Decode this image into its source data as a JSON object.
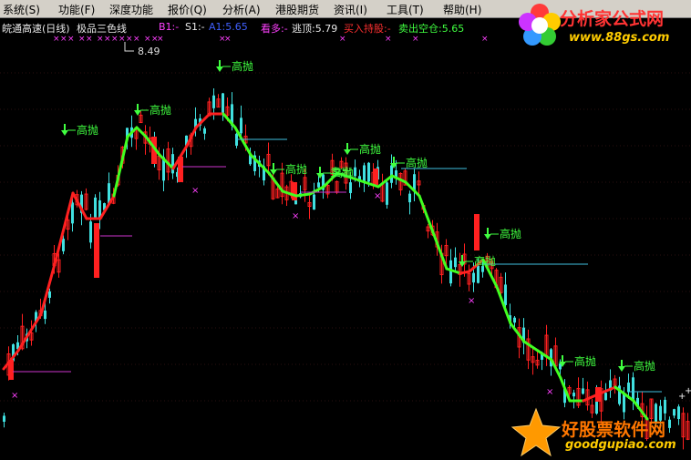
{
  "menu": [
    {
      "label": "系统(S)"
    },
    {
      "label": "功能(F)"
    },
    {
      "label": "深度功能"
    },
    {
      "label": "报价(Q)"
    },
    {
      "label": "分析(A)"
    },
    {
      "label": "港股期货"
    },
    {
      "label": "资讯(I)"
    },
    {
      "label": "工具(T)"
    },
    {
      "label": "帮助(H)"
    }
  ],
  "indicator": {
    "stock": "皖通高速(日线)",
    "name": "极品三色线",
    "b1": "B1:-",
    "s1": "S1:-",
    "a1": "A1:5.65",
    "kanduo": "看多:-",
    "taoding": "逃顶:5.79",
    "mairu": "买入持股:-",
    "maichu": "卖出空仓:5.65"
  },
  "chart_data": {
    "type": "candlestick",
    "high_marker": "8.49",
    "signal_label": "高抛",
    "overlay_text": "卖出",
    "colors": {
      "up": "#ff2020",
      "down": "#40e0e0",
      "line_up": "#ff2020",
      "line_down": "#40ff20",
      "signal": "#40ff40",
      "marker": "#ff40ff"
    }
  },
  "watermarks": {
    "top_title": "分析家公式网",
    "top_url": "www.88gs.com",
    "bottom_title": "好股票软件网",
    "bottom_url": "goodgupiao.com"
  }
}
